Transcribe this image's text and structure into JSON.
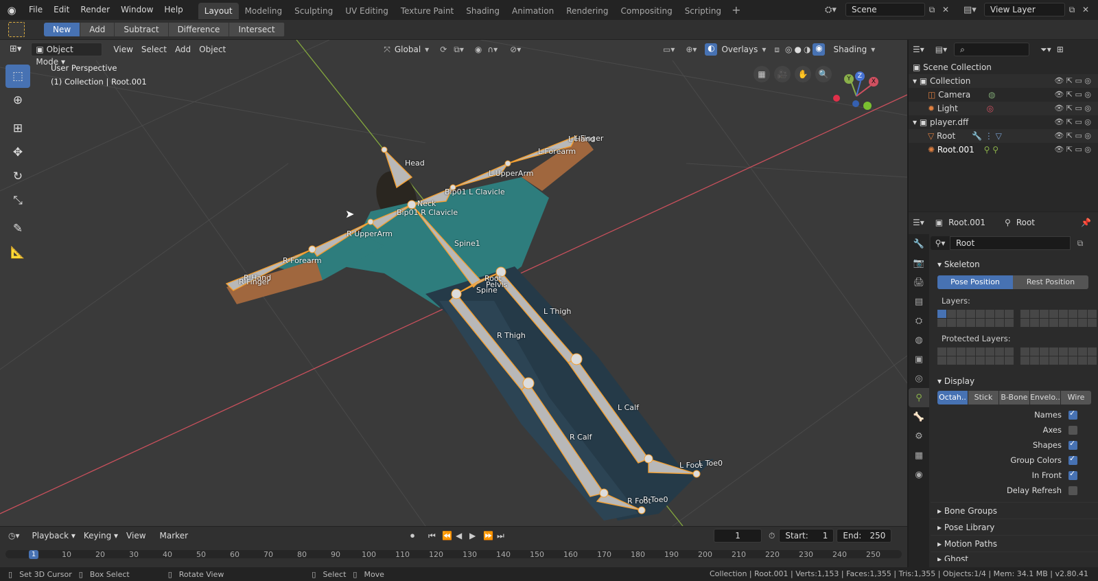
{
  "topbar": {
    "menus": [
      "File",
      "Edit",
      "Render",
      "Window",
      "Help"
    ],
    "workspaces": [
      "Layout",
      "Modeling",
      "Sculpting",
      "UV Editing",
      "Texture Paint",
      "Shading",
      "Animation",
      "Rendering",
      "Compositing",
      "Scripting"
    ],
    "active_workspace": "Layout",
    "scene_name": "Scene",
    "view_layer": "View Layer"
  },
  "toolheader": {
    "bool_ops": [
      "New",
      "Add",
      "Subtract",
      "Difference",
      "Intersect"
    ],
    "active": "New"
  },
  "viewport": {
    "mode": "Object Mode",
    "menus": [
      "View",
      "Select",
      "Add",
      "Object"
    ],
    "orientation": "Global",
    "overlays": "Overlays",
    "shading": "Shading",
    "info_line1": "User Perspective",
    "info_line2": "(1) Collection | Root.001",
    "gizmo_axes": {
      "x": "X",
      "y": "Y",
      "z": "Z"
    },
    "bones": [
      "Head",
      "L Finger",
      "L Hand",
      "L Forearm",
      "L UpperArm",
      "Bip01 L Clavicle",
      "Neck",
      "Bip01 R Clavicle",
      "R UpperArm",
      "R Forearm",
      "R Hand",
      "R Finger",
      "Spine1",
      "Root",
      "Pelvis",
      "Spine",
      "L Thigh",
      "R Thigh",
      "L Calf",
      "R Calf",
      "L Foot",
      "L Toe0",
      "R Foot",
      "R Toe0"
    ]
  },
  "timeline": {
    "menus": [
      "Playback",
      "Keying",
      "View",
      "Marker"
    ],
    "current_frame": "1",
    "start_label": "Start:",
    "start": "1",
    "end_label": "End:",
    "end": "250",
    "ticks": [
      "1",
      "10",
      "20",
      "30",
      "40",
      "50",
      "60",
      "70",
      "80",
      "90",
      "100",
      "110",
      "120",
      "130",
      "140",
      "150",
      "160",
      "170",
      "180",
      "190",
      "200",
      "210",
      "220",
      "230",
      "240",
      "250"
    ]
  },
  "statusbar": {
    "hint1": "Set 3D Cursor",
    "hint2": "Box Select",
    "hint3": "Rotate View",
    "hint4": "Select",
    "hint5": "Move",
    "stats": "Collection | Root.001 | Verts:1,153 | Faces:1,355 | Tris:1,355 | Objects:1/4 | Mem: 34.1 MB | v2.80.41"
  },
  "outliner": {
    "root": "Scene Collection",
    "rows": [
      {
        "label": "Collection"
      },
      {
        "label": "Camera"
      },
      {
        "label": "Light"
      },
      {
        "label": "player.dff"
      },
      {
        "label": "Root"
      },
      {
        "label": "Root.001"
      }
    ]
  },
  "properties": {
    "object": "Root.001",
    "data": "Root",
    "armature_name": "Root",
    "skeleton_title": "Skeleton",
    "pose_position": "Pose Position",
    "rest_position": "Rest Position",
    "layers_label": "Layers:",
    "protected_label": "Protected Layers:",
    "display_title": "Display",
    "display_types": [
      "Octah..",
      "Stick",
      "B-Bone",
      "Envelo..",
      "Wire"
    ],
    "checks": [
      {
        "label": "Names",
        "on": true
      },
      {
        "label": "Axes",
        "on": false
      },
      {
        "label": "Shapes",
        "on": true
      },
      {
        "label": "Group Colors",
        "on": true
      },
      {
        "label": "In Front",
        "on": true
      },
      {
        "label": "Delay Refresh",
        "on": false
      }
    ],
    "subpanels": [
      "Bone Groups",
      "Pose Library",
      "Motion Paths",
      "Ghost"
    ]
  },
  "colors": {
    "accent": "#4772b3",
    "bone_outline": "#f5a030",
    "x_axis": "#d05060",
    "y_axis": "#8ab04a"
  }
}
